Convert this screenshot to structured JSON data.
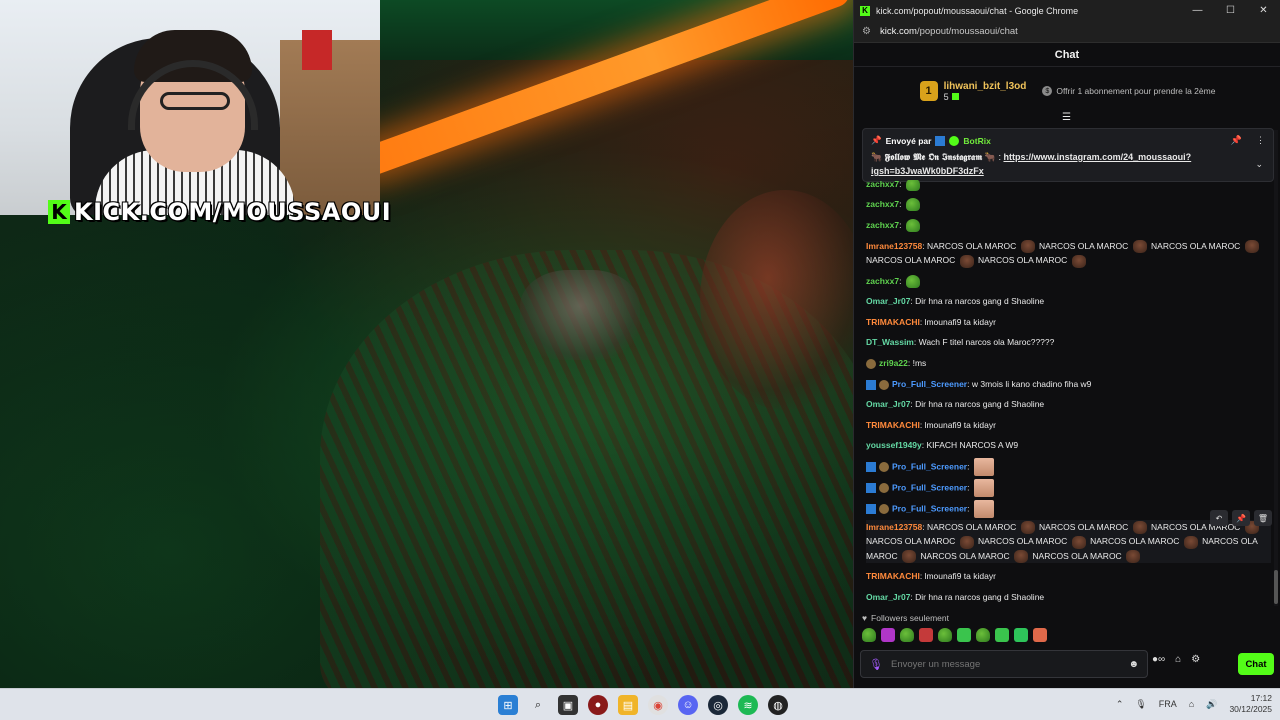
{
  "stream": {
    "brand_text": "KICK.COM/MOUSSAOUI",
    "brand_logo": "K"
  },
  "window": {
    "title": "kick.com/popout/moussaoui/chat - Google Chrome",
    "favicon": "K",
    "url_domain": "kick.com",
    "url_path": "/popout/moussaoui/chat",
    "controls": [
      "—",
      "☐",
      "✕"
    ]
  },
  "chat": {
    "header": "Chat",
    "sub_banner": {
      "badge": "1",
      "username": "lihwani_bzit_l3od",
      "count": "5",
      "offer_text": "Offrir 1 abonnement pour prendre la 2ème"
    },
    "pinned": {
      "sent_by_label": "Envoyé par",
      "bot_name": "BotRix",
      "follow_text": "𝕱𝖔𝖑𝖑𝖔𝖜 𝕸𝖊 𝕺𝖓 𝕴𝖓𝖘𝖙𝖆𝖌𝖗𝖆𝖒",
      "separator": " : ",
      "link": "https://www.instagram.com/24_moussaoui?igsh=b3JwaWk0bDF3dzFx"
    },
    "messages": [
      {
        "user": "zachxx7",
        "color": "#5fd24f",
        "text": ""
      },
      {
        "user": "zachxx7",
        "color": "#5fd24f",
        "text": ""
      },
      {
        "user": "Imrane123758",
        "color": "#ff8a3c",
        "text": "NARCOS OLA MAROC"
      },
      {
        "user": "zachxx7",
        "color": "#5fd24f",
        "text": ""
      },
      {
        "user": "Omar_Jr07",
        "color": "#64d8a4",
        "text": "Dir hna ra narcos gang d Shaoline"
      },
      {
        "user": "TRIMAKACHI",
        "color": "#ff8a3c",
        "text": "lmounafi9 ta kidayr"
      },
      {
        "user": "DT_Wassim",
        "color": "#64d8a4",
        "text": "Wach F titel narcos ola Maroc?????"
      },
      {
        "user": "zri9a22",
        "color": "#5fd24f",
        "text": "!ms"
      },
      {
        "user": "Pro_Full_Screener",
        "color": "#4d9bff",
        "text": "w 3mois li kano chadino fiha w9"
      },
      {
        "user": "Omar_Jr07",
        "color": "#64d8a4",
        "text": "Dir hna ra narcos gang d Shaoline"
      },
      {
        "user": "TRIMAKACHI",
        "color": "#ff8a3c",
        "text": "lmounafi9 ta kidayr"
      },
      {
        "user": "youssef1949y",
        "color": "#64d8a4",
        "text": "KIFACH NARCOS A W9"
      },
      {
        "user": "Pro_Full_Screener",
        "color": "#4d9bff",
        "text": ""
      },
      {
        "user": "Pro_Full_Screener",
        "color": "#4d9bff",
        "text": ""
      },
      {
        "user": "Pro_Full_Screener",
        "color": "#4d9bff",
        "text": ""
      },
      {
        "user": "Imrane123758",
        "color": "#ff8a3c",
        "text": "NARCOS OLA MAROC"
      },
      {
        "user": "TRIMAKACHI",
        "color": "#ff8a3c",
        "text": "lmounafi9 ta kidayr"
      },
      {
        "user": "Omar_Jr07",
        "color": "#64d8a4",
        "text": "Dir hna ra narcos gang d Shaoline"
      }
    ],
    "followers_only": "Followers seulement",
    "input_placeholder": "Envoyer un message",
    "send_label": "Chat"
  },
  "taskbar": {
    "language": "FRA",
    "time": "17:12",
    "date": "30/12/2025"
  },
  "colors": {
    "kick_green": "#53fc18",
    "chat_bg": "#0e0e10"
  }
}
